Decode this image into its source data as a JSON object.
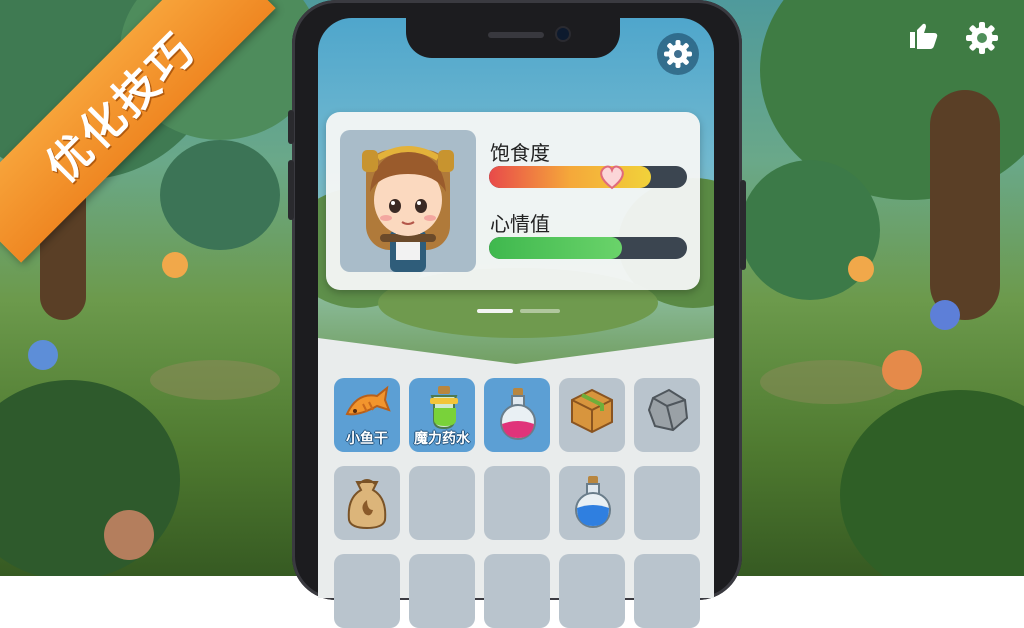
{
  "banner": {
    "text": "优化技巧"
  },
  "top_icons": {
    "left": "hand-icon",
    "right": "gear-icon"
  },
  "screen_settings_icon": "gear-icon",
  "status": {
    "avatar": "girl-character-portrait",
    "satiety": {
      "label": "饱食度",
      "value": 0.82,
      "marker": "heart-icon"
    },
    "mood": {
      "label": "心情值",
      "value": 0.67
    }
  },
  "page_indicator": {
    "count": 2,
    "active": 0
  },
  "inventory": {
    "slots": [
      {
        "icon": "fish-icon",
        "label": "小鱼干",
        "selected": true
      },
      {
        "icon": "green-potion-icon",
        "label": "魔力药水",
        "selected": true
      },
      {
        "icon": "pink-potion-icon",
        "label": "",
        "selected": true
      },
      {
        "icon": "wooden-crate-icon",
        "label": "",
        "selected": false
      },
      {
        "icon": "stone-icon",
        "label": "",
        "selected": false
      },
      {
        "icon": "seed-bag-icon",
        "label": "",
        "selected": false
      },
      {
        "icon": "",
        "label": "",
        "selected": false
      },
      {
        "icon": "",
        "label": "",
        "selected": false
      },
      {
        "icon": "blue-potion-icon",
        "label": "",
        "selected": false
      },
      {
        "icon": "",
        "label": "",
        "selected": false
      }
    ]
  },
  "colors": {
    "banner": "#f39a2f",
    "satiety_gradient": [
      "#e84a4a",
      "#f5a83a",
      "#f1d23a"
    ],
    "mood_fill": "#4fc25a",
    "selected_slot": "#5c9fd4",
    "empty_slot": "#b9c4cd"
  }
}
